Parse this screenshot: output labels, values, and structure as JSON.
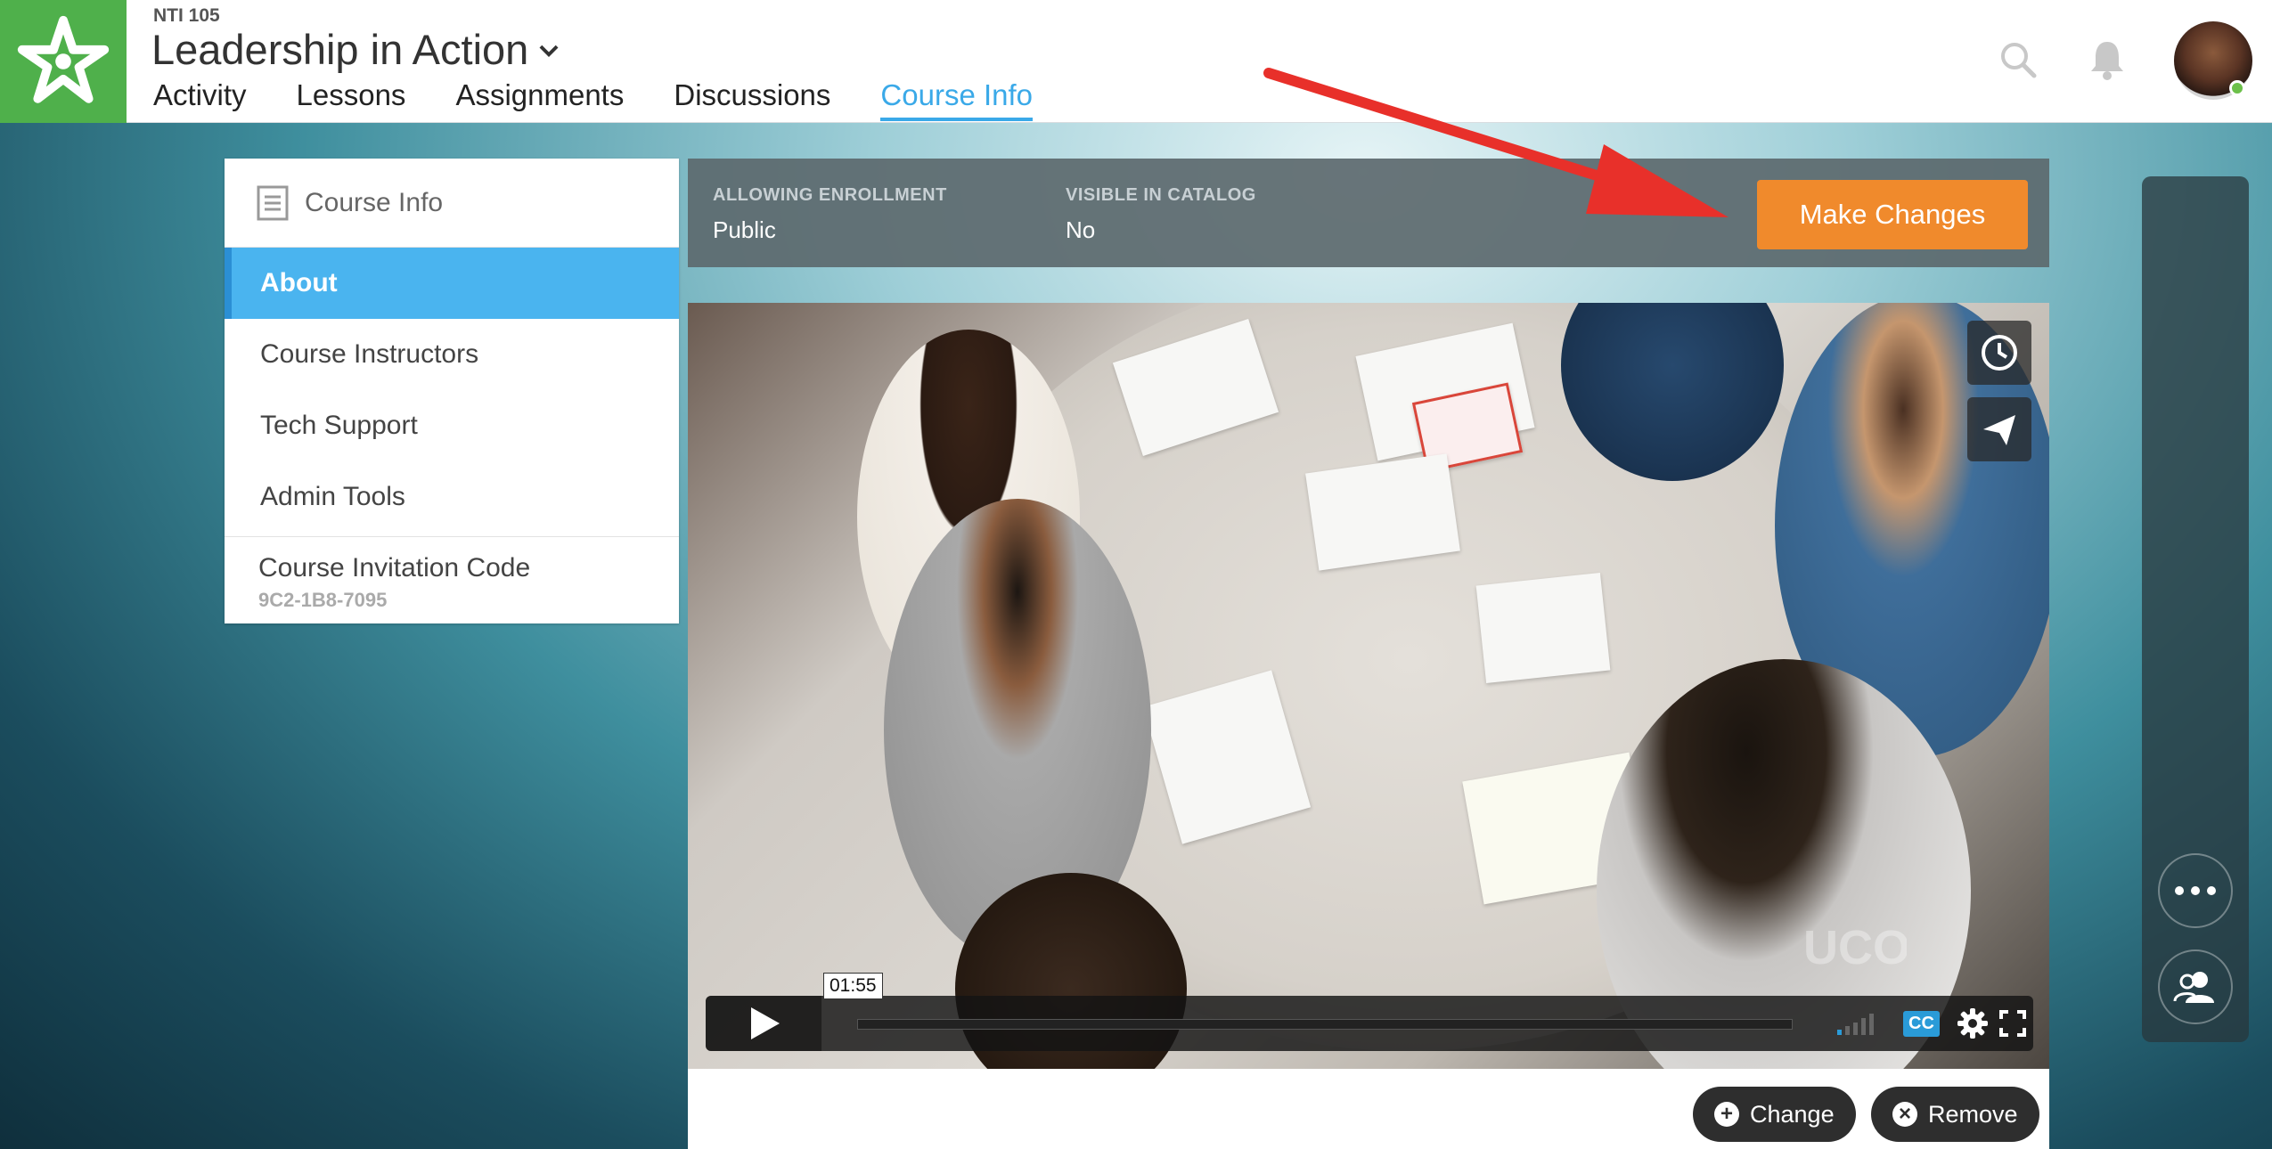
{
  "header": {
    "course_code": "NTI 105",
    "course_title": "Leadership in Action",
    "tabs": [
      {
        "label": "Activity"
      },
      {
        "label": "Lessons"
      },
      {
        "label": "Assignments"
      },
      {
        "label": "Discussions"
      },
      {
        "label": "Course Info",
        "active": true
      }
    ],
    "icons": [
      "search-icon",
      "bell-icon",
      "avatar"
    ]
  },
  "sidebar": {
    "title": "Course Info",
    "items": [
      {
        "label": "About",
        "active": true
      },
      {
        "label": "Course Instructors"
      },
      {
        "label": "Tech Support"
      },
      {
        "label": "Admin Tools"
      }
    ],
    "invite_label": "Course Invitation Code",
    "invite_code": "9C2-1B8-7095"
  },
  "infobar": {
    "enrollment_label": "ALLOWING ENROLLMENT",
    "enrollment_value": "Public",
    "catalog_label": "VISIBLE IN CATALOG",
    "catalog_value": "No",
    "make_changes_label": "Make Changes"
  },
  "video": {
    "timestamp": "01:55",
    "cc_label": "CC",
    "watermark": "UCO"
  },
  "media_actions": {
    "change_label": "Change",
    "remove_label": "Remove"
  },
  "colors": {
    "brand_green": "#4fb04b",
    "accent_blue": "#3aa9e8",
    "make_changes_orange": "#f08a2c",
    "annotation_red": "#e8302a"
  }
}
